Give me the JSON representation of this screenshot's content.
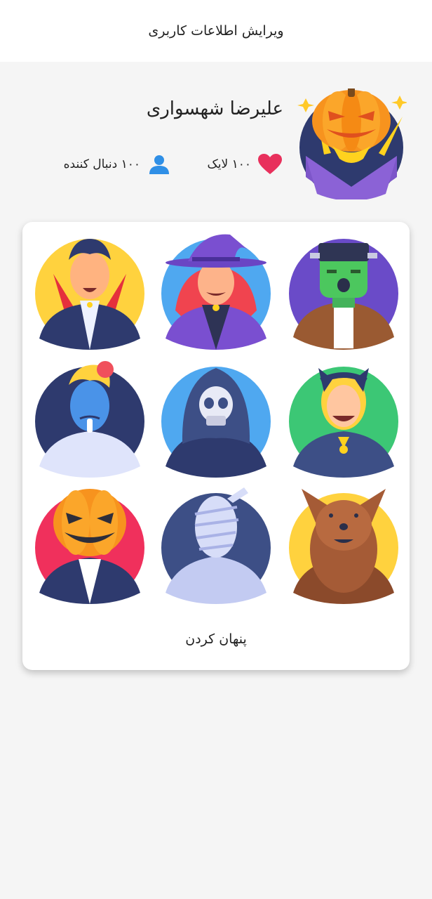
{
  "header": {
    "title": "ویرایش اطلاعات کاربری"
  },
  "profile": {
    "name": "علیرضا شهسواری",
    "likes_text": "۱۰۰ لایک",
    "followers_text": "۱۰۰ دنبال کننده",
    "avatar_icon": "pumpkin-avatar-icon"
  },
  "avatar_picker": {
    "avatars": [
      "frankenstein-avatar",
      "witch-avatar",
      "vampire-avatar",
      "cat-girl-avatar",
      "grim-reaper-avatar",
      "zombie-avatar",
      "werewolf-avatar",
      "mummy-avatar",
      "pumpkin-head-avatar"
    ],
    "hide_label": "پنهان کردن"
  },
  "colors": {
    "heart": "#e8305c",
    "person_icon": "#2f8fe6",
    "background": "#f5f5f5",
    "card": "#ffffff"
  }
}
